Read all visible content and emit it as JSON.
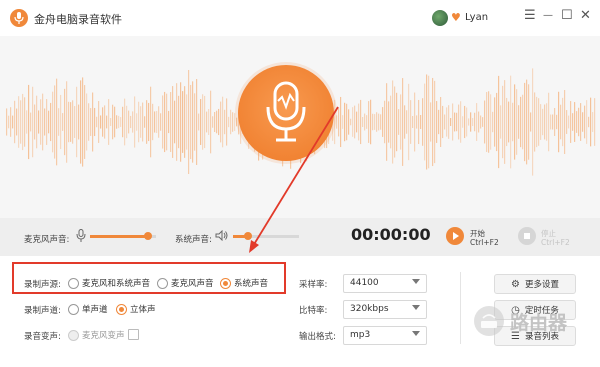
{
  "app": {
    "title": "金舟电脑录音软件"
  },
  "user": {
    "name": "Lyan"
  },
  "window_controls": {
    "menu": "☰",
    "minimize": "—",
    "maximize": "☐",
    "close": "✕"
  },
  "controls": {
    "mic_label": "麦克风声音:",
    "mic_level": 0.88,
    "system_label": "系统声音:",
    "system_level": 0.22,
    "timer": "00:00:00",
    "start_label": "开始",
    "start_shortcut": "Ctrl+F2",
    "stop_label": "停止",
    "stop_shortcut": "Ctrl+F2"
  },
  "settings": {
    "record_source_label": "录制声源:",
    "record_source_options": [
      "麦克风和系统声音",
      "麦克风声音",
      "系统声音"
    ],
    "record_source_selected": "系统声音",
    "channel_label": "录制声道:",
    "channel_options": [
      "单声道",
      "立体声"
    ],
    "channel_selected": "立体声",
    "voice_change_label": "录音变声:",
    "voice_change_option": "麦克风变声",
    "sample_rate_label": "采样率:",
    "sample_rate_value": "44100",
    "bitrate_label": "比特率:",
    "bitrate_value": "320kbps",
    "format_label": "输出格式:",
    "format_value": "mp3",
    "more_settings": "更多设置",
    "scheduled_task": "定时任务",
    "record_list": "录音列表"
  },
  "watermark": {
    "text": "路由器"
  },
  "colors": {
    "accent": "#f0883a",
    "highlight": "#e23a2a"
  }
}
